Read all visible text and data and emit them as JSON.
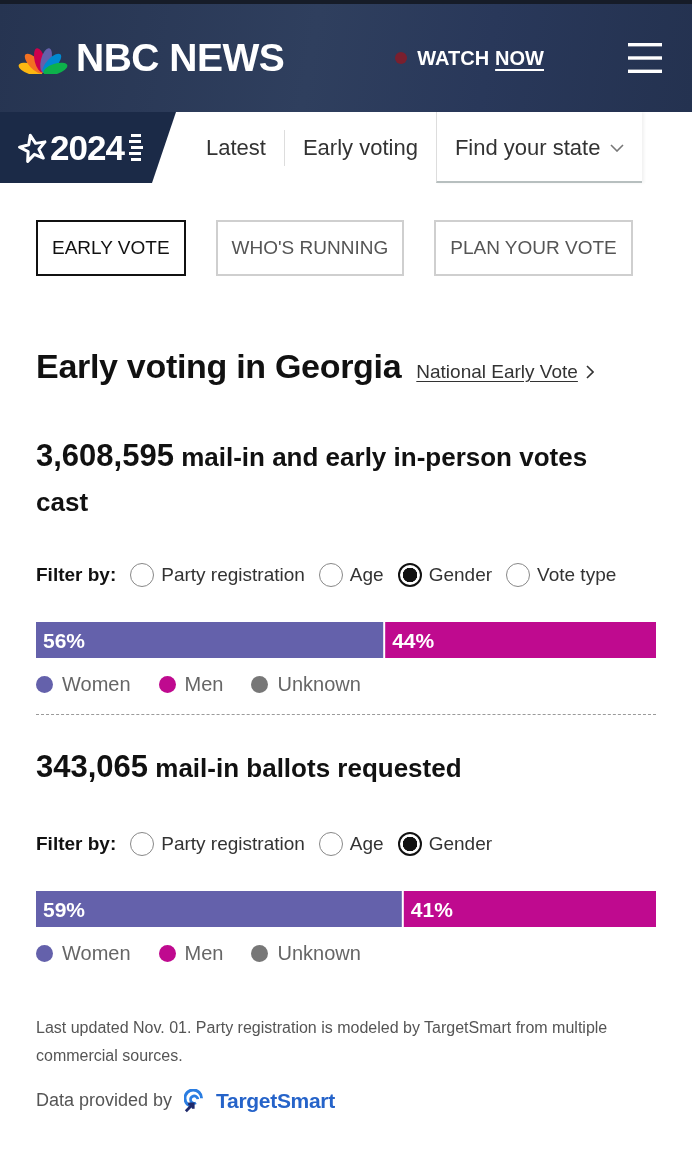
{
  "header": {
    "logo": "NBC NEWS",
    "watch_label": "WATCH",
    "watch_emphasis": "NOW"
  },
  "election_nav": {
    "badge": "2024",
    "items": [
      {
        "label": "Latest",
        "kind": "link"
      },
      {
        "label": "Early voting",
        "kind": "link"
      },
      {
        "label": "Find your state",
        "kind": "dropdown"
      }
    ]
  },
  "tabs": [
    {
      "label": "EARLY VOTE",
      "selected": true
    },
    {
      "label": "WHO'S RUNNING",
      "selected": false
    },
    {
      "label": "PLAN YOUR VOTE",
      "selected": false
    }
  ],
  "title": "Early voting in Georgia",
  "title_link": "National Early Vote",
  "sections": [
    {
      "count": "3,608,595",
      "caption": "mail-in and early in-person votes cast",
      "filter_label": "Filter by:",
      "filters": [
        {
          "label": "Party registration",
          "selected": false
        },
        {
          "label": "Age",
          "selected": false
        },
        {
          "label": "Gender",
          "selected": true
        },
        {
          "label": "Vote type",
          "selected": false
        }
      ],
      "chart_data": {
        "type": "bar",
        "orientation": "horizontal",
        "stacked": true,
        "categories": [
          null
        ],
        "series": [
          {
            "name": "Women",
            "color": "#6461ab",
            "values": [
              56
            ],
            "value_labels": [
              "56%"
            ]
          },
          {
            "name": "Men",
            "color": "#bf0a8f",
            "values": [
              44
            ],
            "value_labels": [
              "44%"
            ]
          },
          {
            "name": "Unknown",
            "color": "#777777",
            "values": [
              null
            ],
            "value_labels": [
              null
            ]
          }
        ],
        "legend": "bottom"
      }
    },
    {
      "count": "343,065",
      "caption": "mail-in ballots requested",
      "filter_label": "Filter by:",
      "filters": [
        {
          "label": "Party registration",
          "selected": false
        },
        {
          "label": "Age",
          "selected": false
        },
        {
          "label": "Gender",
          "selected": true
        }
      ],
      "chart_data": {
        "type": "bar",
        "orientation": "horizontal",
        "stacked": true,
        "categories": [
          null
        ],
        "series": [
          {
            "name": "Women",
            "color": "#6461ab",
            "values": [
              59
            ],
            "value_labels": [
              "59%"
            ]
          },
          {
            "name": "Men",
            "color": "#bf0a8f",
            "values": [
              41
            ],
            "value_labels": [
              "41%"
            ]
          },
          {
            "name": "Unknown",
            "color": "#777777",
            "values": [
              null
            ],
            "value_labels": [
              null
            ]
          }
        ],
        "legend": "bottom"
      }
    }
  ],
  "footnote": "Last updated Nov. 01. Party registration is modeled by TargetSmart from multiple commercial sources.",
  "credit": {
    "label": "Data provided by",
    "brand": "TargetSmart"
  }
}
